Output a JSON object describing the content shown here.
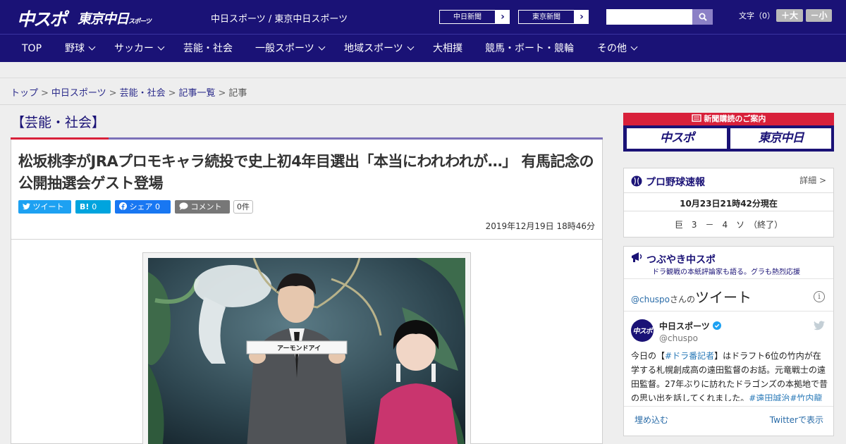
{
  "header": {
    "logo_main": "中スポ",
    "logo_tokyo": "東京中日",
    "logo_tokyo_sub": "スポーツ",
    "site_name": "中日スポーツ / 東京中日スポーツ",
    "ext_links": [
      {
        "label": "中日新聞",
        "arrow": "›"
      },
      {
        "label": "東京新聞",
        "arrow": "›"
      }
    ],
    "search_placeholder": "",
    "font_size_label": "文字（0）",
    "font_plus": "＋大",
    "font_minus": "－小"
  },
  "nav": {
    "items": [
      {
        "label": "TOP",
        "dropdown": false
      },
      {
        "label": "野球",
        "dropdown": true
      },
      {
        "label": "サッカー",
        "dropdown": true
      },
      {
        "label": "芸能・社会",
        "dropdown": false
      },
      {
        "label": "一般スポーツ",
        "dropdown": true
      },
      {
        "label": "地域スポーツ",
        "dropdown": true
      },
      {
        "label": "大相撲",
        "dropdown": false
      },
      {
        "label": "競馬・ボート・競輪",
        "dropdown": false
      },
      {
        "label": "その他",
        "dropdown": true
      }
    ]
  },
  "breadcrumb": {
    "items": [
      "トップ",
      "中日スポーツ",
      "芸能・社会",
      "記事一覧"
    ],
    "current": "記事",
    "separator": ">"
  },
  "article": {
    "category": "【芸能・社会】",
    "headline": "松坂桃李がJRAプロモキャラ続投で史上初4年目選出「本当にわれわれが…」 有馬記念の公開抽選会ゲスト登場",
    "share": {
      "tweet": "ツイート",
      "hatena": "B!",
      "hatena_count": "0",
      "facebook": "シェア",
      "facebook_count": "0",
      "comment": "コメント",
      "comment_count": "0件"
    },
    "date": "2019年12月19日 18時46分",
    "photo_card_text": "アーモンドアイ"
  },
  "sidebar": {
    "subscribe_title": "新聞購読のご案内",
    "subscribe_logos": [
      "中スポ",
      "東京中日"
    ],
    "baseball": {
      "title": "プロ野球速報",
      "detail": "詳細 >",
      "updated": "10月23日21時42分現在",
      "score": "巨　3　－　4　ソ　（終了）"
    },
    "tweets": {
      "title": "つぶやき中スポ",
      "subtitle": "ドラ観戦の本紙評論家も語る。グラも熱烈応援",
      "handle": "@chuspo",
      "handle_suffix": "さんの",
      "tweet_word": "ツイート",
      "info": "i",
      "author": "中日スポーツ",
      "author_handle": "@chuspo",
      "text_1": "今日の【",
      "text_tag1": "#ドラ番記者",
      "text_2": "】はドラフト6位の竹内が在学する札幌創成高の遠田監督のお話。元竜戦士の遠田監督。27年ぶりに訪れたドラゴンズの本拠地で昔の思い出を話してくれました。",
      "text_tag2": "#遠田誠治",
      "text_tag3": "#竹内龍臣",
      "text_tag4": "#",
      "embed": "埋め込む",
      "view_on": "Twitterで表示"
    }
  },
  "colors": {
    "brand": "#1a1276",
    "accent_red": "#d8203a",
    "twitter": "#1da1f2",
    "facebook": "#1877f2",
    "hatena": "#00a4de"
  }
}
